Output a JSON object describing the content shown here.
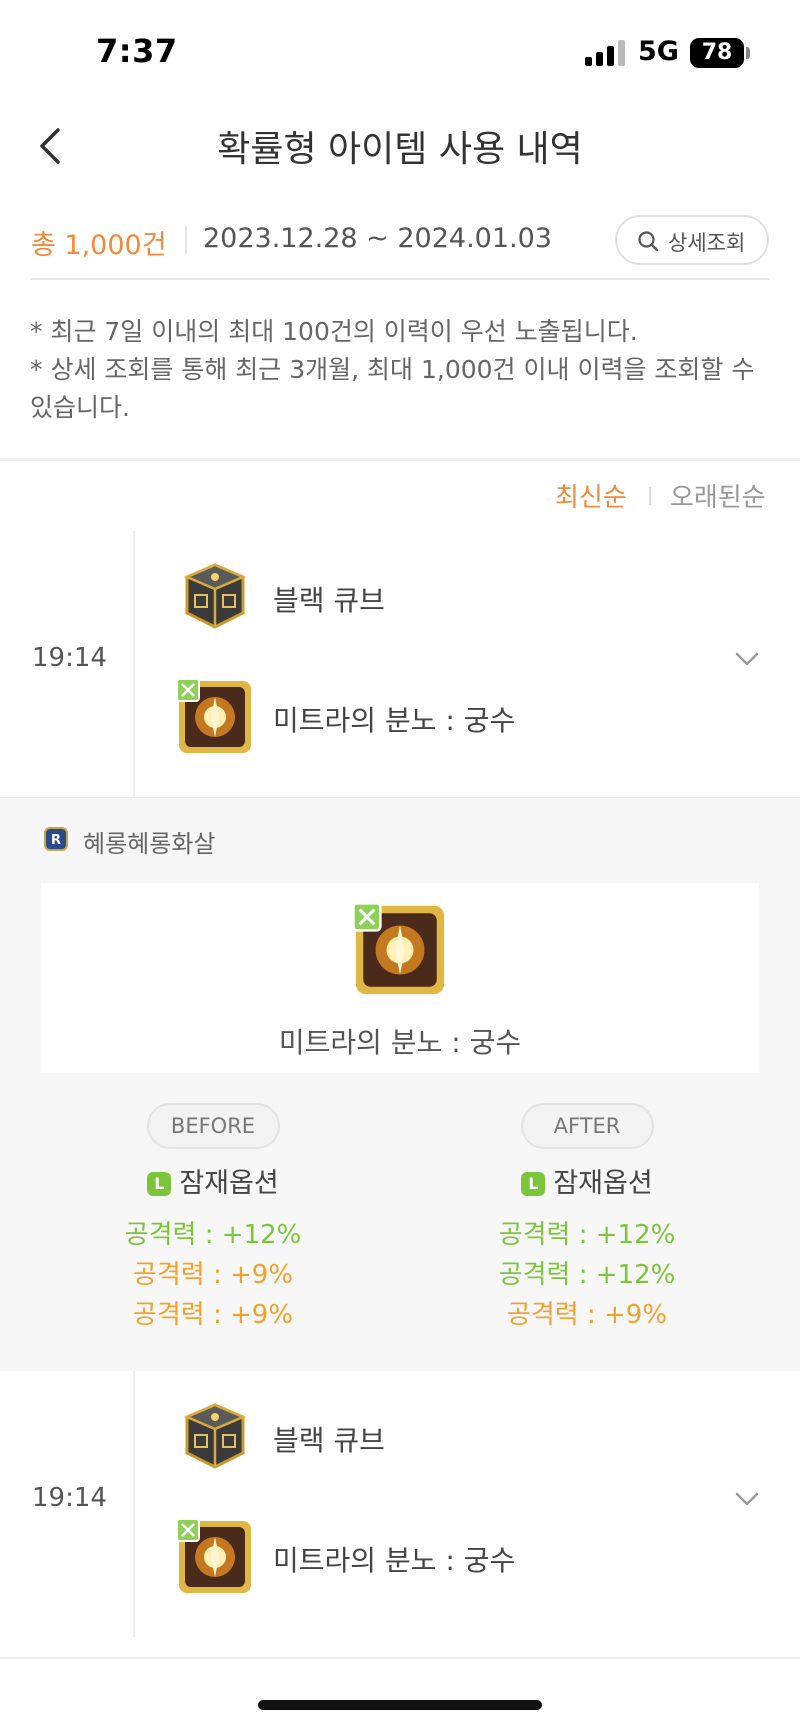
{
  "status_bar": {
    "time": "7:37",
    "network": "5G",
    "battery": "78"
  },
  "header": {
    "title": "확률형 아이템 사용 내역"
  },
  "summary": {
    "total": "총 1,000건",
    "date_range": "2023.12.28 ~ 2024.01.03",
    "detail_button": "상세조회"
  },
  "notice": {
    "line1": "* 최근 7일 이내의 최대 100건의 이력이 우선 노출됩니다.",
    "line2": "* 상세 조회를 통해 최근 3개월, 최대 1,000건 이내 이력을 조회할 수 있습니다."
  },
  "sort": {
    "newest": "최신순",
    "oldest": "오래된순"
  },
  "entries": [
    {
      "time": "19:14",
      "item": "블랙 큐브",
      "target": "미트라의 분노 : 궁수",
      "expanded": true
    },
    {
      "time": "19:14",
      "item": "블랙 큐브",
      "target": "미트라의 분노 : 궁수",
      "expanded": false
    }
  ],
  "detail": {
    "character": "혜롱혜롱화살",
    "item_name": "미트라의 분노 : 궁수",
    "before": {
      "label": "BEFORE",
      "option_title": "잠재옵션",
      "grade_badge": "L",
      "lines": [
        "공격력 : +12%",
        "공격력 : +9%",
        "공격력 : +9%"
      ]
    },
    "after": {
      "label": "AFTER",
      "option_title": "잠재옵션",
      "grade_badge": "L",
      "lines": [
        "공격력 : +12%",
        "공격력 : +12%",
        "공격력 : +9%"
      ]
    }
  },
  "colors": {
    "accent_orange": "#f08a3c",
    "legendary_green": "#7cc43a",
    "unique_orange": "#f3a12c"
  }
}
